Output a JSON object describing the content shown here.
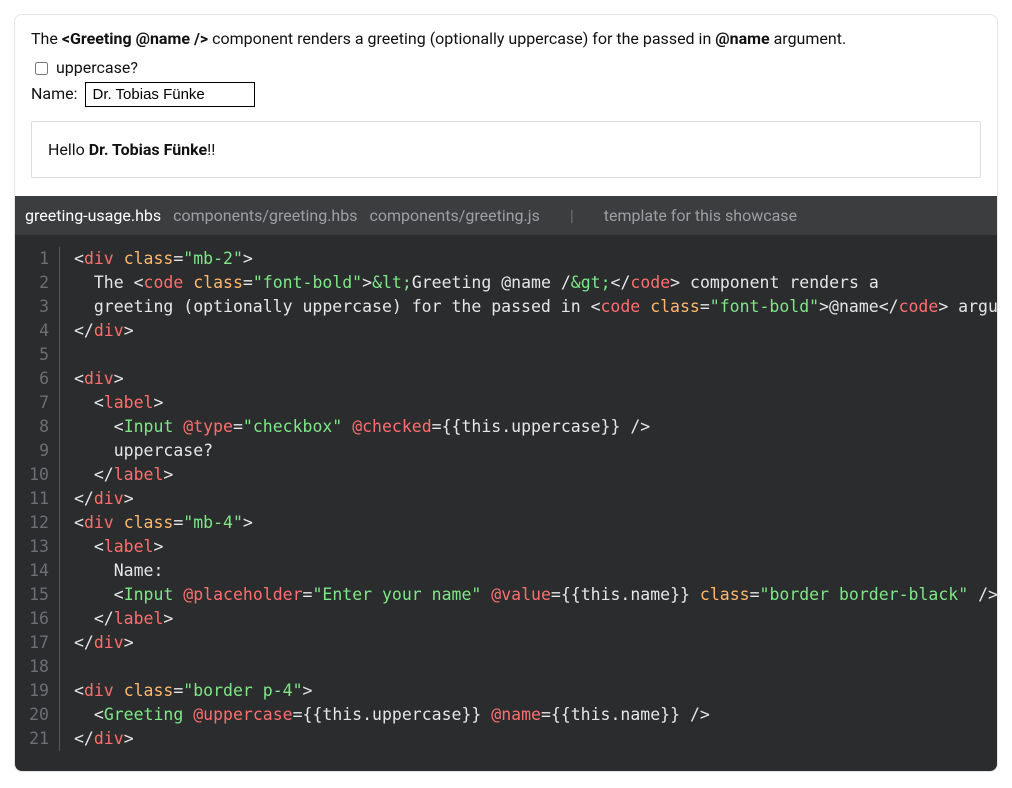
{
  "desc": {
    "prefix": "The ",
    "code1": "<Greeting @name />",
    "mid": " component renders a greeting (optionally uppercase) for the passed in ",
    "code2": "@name",
    "suffix": " argument."
  },
  "controls": {
    "uppercase_label": "uppercase?",
    "name_label": "Name:",
    "name_value": "Dr. Tobias Fünke"
  },
  "greeting": {
    "hello": "Hello ",
    "name": "Dr. Tobias Fünke",
    "bang": "!!"
  },
  "tabs": {
    "t1": "greeting-usage.hbs",
    "t2": "components/greeting.hbs",
    "t3": "components/greeting.js",
    "sep": "|",
    "t4": "template for this showcase"
  },
  "code": [
    [
      [
        "punct",
        "<"
      ],
      [
        "tag",
        "div"
      ],
      [
        "text",
        " "
      ],
      [
        "attr",
        "class"
      ],
      [
        "punct",
        "="
      ],
      [
        "str",
        "\"mb-2\""
      ],
      [
        "punct",
        ">"
      ]
    ],
    [
      [
        "text",
        "  The "
      ],
      [
        "punct",
        "<"
      ],
      [
        "tag",
        "code"
      ],
      [
        "text",
        " "
      ],
      [
        "attr",
        "class"
      ],
      [
        "punct",
        "="
      ],
      [
        "str",
        "\"font-bold\""
      ],
      [
        "punct",
        ">"
      ],
      [
        "comp",
        "&lt;"
      ],
      [
        "text",
        "Greeting @name /"
      ],
      [
        "comp",
        "&gt;"
      ],
      [
        "punct",
        "</"
      ],
      [
        "tag",
        "code"
      ],
      [
        "punct",
        ">"
      ],
      [
        "text",
        " component renders a"
      ]
    ],
    [
      [
        "text",
        "  greeting (optionally uppercase) for the passed in "
      ],
      [
        "punct",
        "<"
      ],
      [
        "tag",
        "code"
      ],
      [
        "text",
        " "
      ],
      [
        "attr",
        "class"
      ],
      [
        "punct",
        "="
      ],
      [
        "str",
        "\"font-bold\""
      ],
      [
        "punct",
        ">"
      ],
      [
        "text",
        "@name"
      ],
      [
        "punct",
        "</"
      ],
      [
        "tag",
        "code"
      ],
      [
        "punct",
        ">"
      ],
      [
        "text",
        " argument."
      ]
    ],
    [
      [
        "punct",
        "</"
      ],
      [
        "tag",
        "div"
      ],
      [
        "punct",
        ">"
      ]
    ],
    [],
    [
      [
        "punct",
        "<"
      ],
      [
        "tag",
        "div"
      ],
      [
        "punct",
        ">"
      ]
    ],
    [
      [
        "text",
        "  "
      ],
      [
        "punct",
        "<"
      ],
      [
        "tag",
        "label"
      ],
      [
        "punct",
        ">"
      ]
    ],
    [
      [
        "text",
        "    "
      ],
      [
        "punct",
        "<"
      ],
      [
        "comp",
        "Input"
      ],
      [
        "text",
        " "
      ],
      [
        "arg",
        "@type"
      ],
      [
        "punct",
        "="
      ],
      [
        "str",
        "\"checkbox\""
      ],
      [
        "text",
        " "
      ],
      [
        "arg",
        "@checked"
      ],
      [
        "punct",
        "="
      ],
      [
        "expr",
        "{{this.uppercase}}"
      ],
      [
        "text",
        " "
      ],
      [
        "punct",
        "/>"
      ]
    ],
    [
      [
        "text",
        "    uppercase?"
      ]
    ],
    [
      [
        "text",
        "  "
      ],
      [
        "punct",
        "</"
      ],
      [
        "tag",
        "label"
      ],
      [
        "punct",
        ">"
      ]
    ],
    [
      [
        "punct",
        "</"
      ],
      [
        "tag",
        "div"
      ],
      [
        "punct",
        ">"
      ]
    ],
    [
      [
        "punct",
        "<"
      ],
      [
        "tag",
        "div"
      ],
      [
        "text",
        " "
      ],
      [
        "attr",
        "class"
      ],
      [
        "punct",
        "="
      ],
      [
        "str",
        "\"mb-4\""
      ],
      [
        "punct",
        ">"
      ]
    ],
    [
      [
        "text",
        "  "
      ],
      [
        "punct",
        "<"
      ],
      [
        "tag",
        "label"
      ],
      [
        "punct",
        ">"
      ]
    ],
    [
      [
        "text",
        "    Name:"
      ]
    ],
    [
      [
        "text",
        "    "
      ],
      [
        "punct",
        "<"
      ],
      [
        "comp",
        "Input"
      ],
      [
        "text",
        " "
      ],
      [
        "arg",
        "@placeholder"
      ],
      [
        "punct",
        "="
      ],
      [
        "str",
        "\"Enter your name\""
      ],
      [
        "text",
        " "
      ],
      [
        "arg",
        "@value"
      ],
      [
        "punct",
        "="
      ],
      [
        "expr",
        "{{this.name}}"
      ],
      [
        "text",
        " "
      ],
      [
        "attr",
        "class"
      ],
      [
        "punct",
        "="
      ],
      [
        "str",
        "\"border border-black\""
      ],
      [
        "text",
        " "
      ],
      [
        "punct",
        "/>"
      ]
    ],
    [
      [
        "text",
        "  "
      ],
      [
        "punct",
        "</"
      ],
      [
        "tag",
        "label"
      ],
      [
        "punct",
        ">"
      ]
    ],
    [
      [
        "punct",
        "</"
      ],
      [
        "tag",
        "div"
      ],
      [
        "punct",
        ">"
      ]
    ],
    [],
    [
      [
        "punct",
        "<"
      ],
      [
        "tag",
        "div"
      ],
      [
        "text",
        " "
      ],
      [
        "attr",
        "class"
      ],
      [
        "punct",
        "="
      ],
      [
        "str",
        "\"border p-4\""
      ],
      [
        "punct",
        ">"
      ]
    ],
    [
      [
        "text",
        "  "
      ],
      [
        "punct",
        "<"
      ],
      [
        "comp",
        "Greeting"
      ],
      [
        "text",
        " "
      ],
      [
        "arg",
        "@uppercase"
      ],
      [
        "punct",
        "="
      ],
      [
        "expr",
        "{{this.uppercase}}"
      ],
      [
        "text",
        " "
      ],
      [
        "arg",
        "@name"
      ],
      [
        "punct",
        "="
      ],
      [
        "expr",
        "{{this.name}}"
      ],
      [
        "text",
        " "
      ],
      [
        "punct",
        "/>"
      ]
    ],
    [
      [
        "punct",
        "</"
      ],
      [
        "tag",
        "div"
      ],
      [
        "punct",
        ">"
      ]
    ]
  ]
}
